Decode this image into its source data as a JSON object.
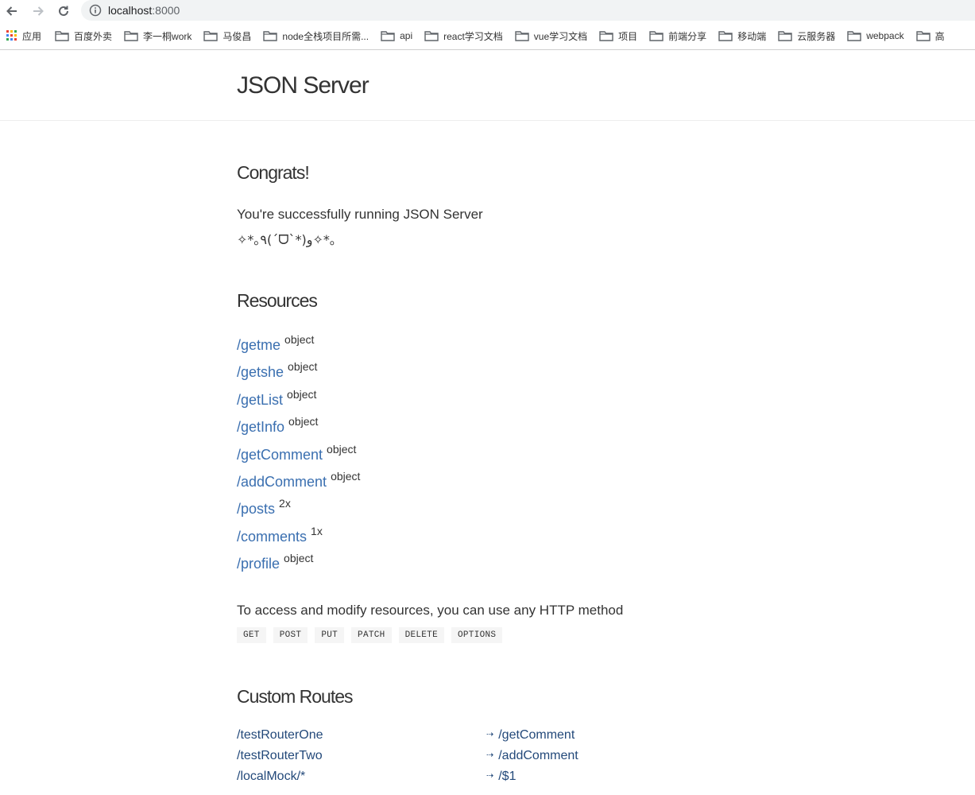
{
  "browser": {
    "url_host": "localhost",
    "url_port": ":8000",
    "bookmarks": [
      {
        "label": "应用",
        "icon": "apps-grid-icon"
      },
      {
        "label": "百度外卖",
        "icon": "folder-icon"
      },
      {
        "label": "李一桐work",
        "icon": "folder-icon"
      },
      {
        "label": "马俊昌",
        "icon": "folder-icon"
      },
      {
        "label": "node全栈项目所需...",
        "icon": "folder-icon"
      },
      {
        "label": "api",
        "icon": "folder-icon"
      },
      {
        "label": "react学习文档",
        "icon": "folder-icon"
      },
      {
        "label": "vue学习文档",
        "icon": "folder-icon"
      },
      {
        "label": "项目",
        "icon": "folder-icon"
      },
      {
        "label": "前端分享",
        "icon": "folder-icon"
      },
      {
        "label": "移动端",
        "icon": "folder-icon"
      },
      {
        "label": "云服务器",
        "icon": "folder-icon"
      },
      {
        "label": "webpack",
        "icon": "folder-icon"
      },
      {
        "label": "高",
        "icon": "folder-icon"
      }
    ]
  },
  "header": {
    "title": "JSON Server"
  },
  "congrats": {
    "heading": "Congrats!",
    "line1": "You're successfully running JSON Server",
    "line2": "✧*｡٩(ˊᗜˋ*)و✧*｡"
  },
  "resources": {
    "heading": "Resources",
    "items": [
      {
        "path": "/getme",
        "type": "object"
      },
      {
        "path": "/getshe",
        "type": "object"
      },
      {
        "path": "/getList",
        "type": "object"
      },
      {
        "path": "/getInfo",
        "type": "object"
      },
      {
        "path": "/getComment",
        "type": "object"
      },
      {
        "path": "/addComment",
        "type": "object"
      },
      {
        "path": "/posts",
        "type": "2x"
      },
      {
        "path": "/comments",
        "type": "1x"
      },
      {
        "path": "/profile",
        "type": "object"
      }
    ],
    "access_text": "To access and modify resources, you can use any HTTP method",
    "methods": [
      "GET",
      "POST",
      "PUT",
      "PATCH",
      "DELETE",
      "OPTIONS"
    ]
  },
  "custom_routes": {
    "heading": "Custom Routes",
    "arrow": "⇢",
    "routes": [
      {
        "from": "/testRouterOne",
        "to": "/getComment"
      },
      {
        "from": "/testRouterTwo",
        "to": "/addComment"
      },
      {
        "from": "/localMock/*",
        "to": "/$1"
      }
    ]
  }
}
